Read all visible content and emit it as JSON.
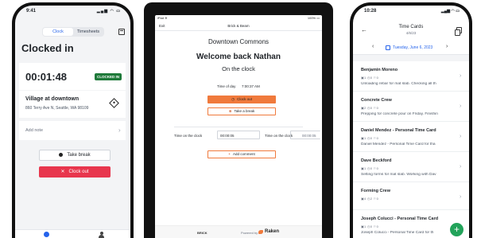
{
  "phone1": {
    "status_time": "9:41",
    "status_icons": "▂▄▆ ◠ ▭",
    "tabs": [
      "Clock",
      "Timesheets"
    ],
    "title": "Clocked in",
    "timer": "00:01:48",
    "badge": "CLOCKED IN",
    "location_name": "Village at downtown",
    "location_address": "860 Terry Ave N, Seattle, WA 98109",
    "note_placeholder": "Add note",
    "take_break_label": "Take break",
    "clock_out_label": "Clock out",
    "clock_out_icon": "✕"
  },
  "tablet": {
    "status_left": "iPad ≋",
    "status_right": "100% ▭",
    "exit_label": "Exit",
    "company": "Brick & Beam",
    "project": "Downtown Commons",
    "welcome": "Welcome back Nathan",
    "status": "On the clock",
    "time_of_day_label": "Time of day",
    "time_of_day_value": "7:00:37 AM",
    "clock_out_label": "Clock out",
    "take_break_label": "Take a break",
    "time_on_clock_label": "Time on the clock",
    "time_on_clock_value": "00:00:05",
    "time_on_clock_label2": "Time on the clock",
    "time_on_clock_value2": "00:00:05",
    "add_comment_label": "Add comment",
    "footer_brand": "BRICK",
    "powered_by": "Powered by",
    "raken": "Raken"
  },
  "phone3": {
    "status_time": "10:28",
    "status_icons": "▂▄▆ ◠ ▭",
    "title": "Time Cards",
    "subtitle": "4/6/23",
    "date": "Tuesday, June 6, 2023",
    "meta": "▣1  ◷0  ⚐0",
    "items": [
      {
        "name": "Benjamin Moreno",
        "meta": "▣1  ◷0  ⚐0",
        "desc": "Unloading rebar for mat slab. Checking all th"
      },
      {
        "name": "Concrete Crew",
        "meta": "▣2  ◷0  ⚐0",
        "desc": "Prepping for concrete pour on Friday. Finishin"
      },
      {
        "name": "Daniel Mendez - Personal Time Card",
        "meta": "▣1  ◷0  ⚐0",
        "desc": "Daniel Mendez - Personal Time Card for tha"
      },
      {
        "name": "Dave Beckford",
        "meta": "▣1  ◷0  ⚐0",
        "desc": "Setting forms for mat slab. Working with Dav"
      },
      {
        "name": "Forming Crew",
        "meta": "▣4  ◷2  ⚐0",
        "desc": ""
      },
      {
        "name": "Joseph Colucci - Personal Time Card",
        "meta": "▣1  ◷0  ⚐0",
        "desc": "Joseph Colucci - Personal Time Card for th"
      }
    ],
    "fab": "+"
  }
}
